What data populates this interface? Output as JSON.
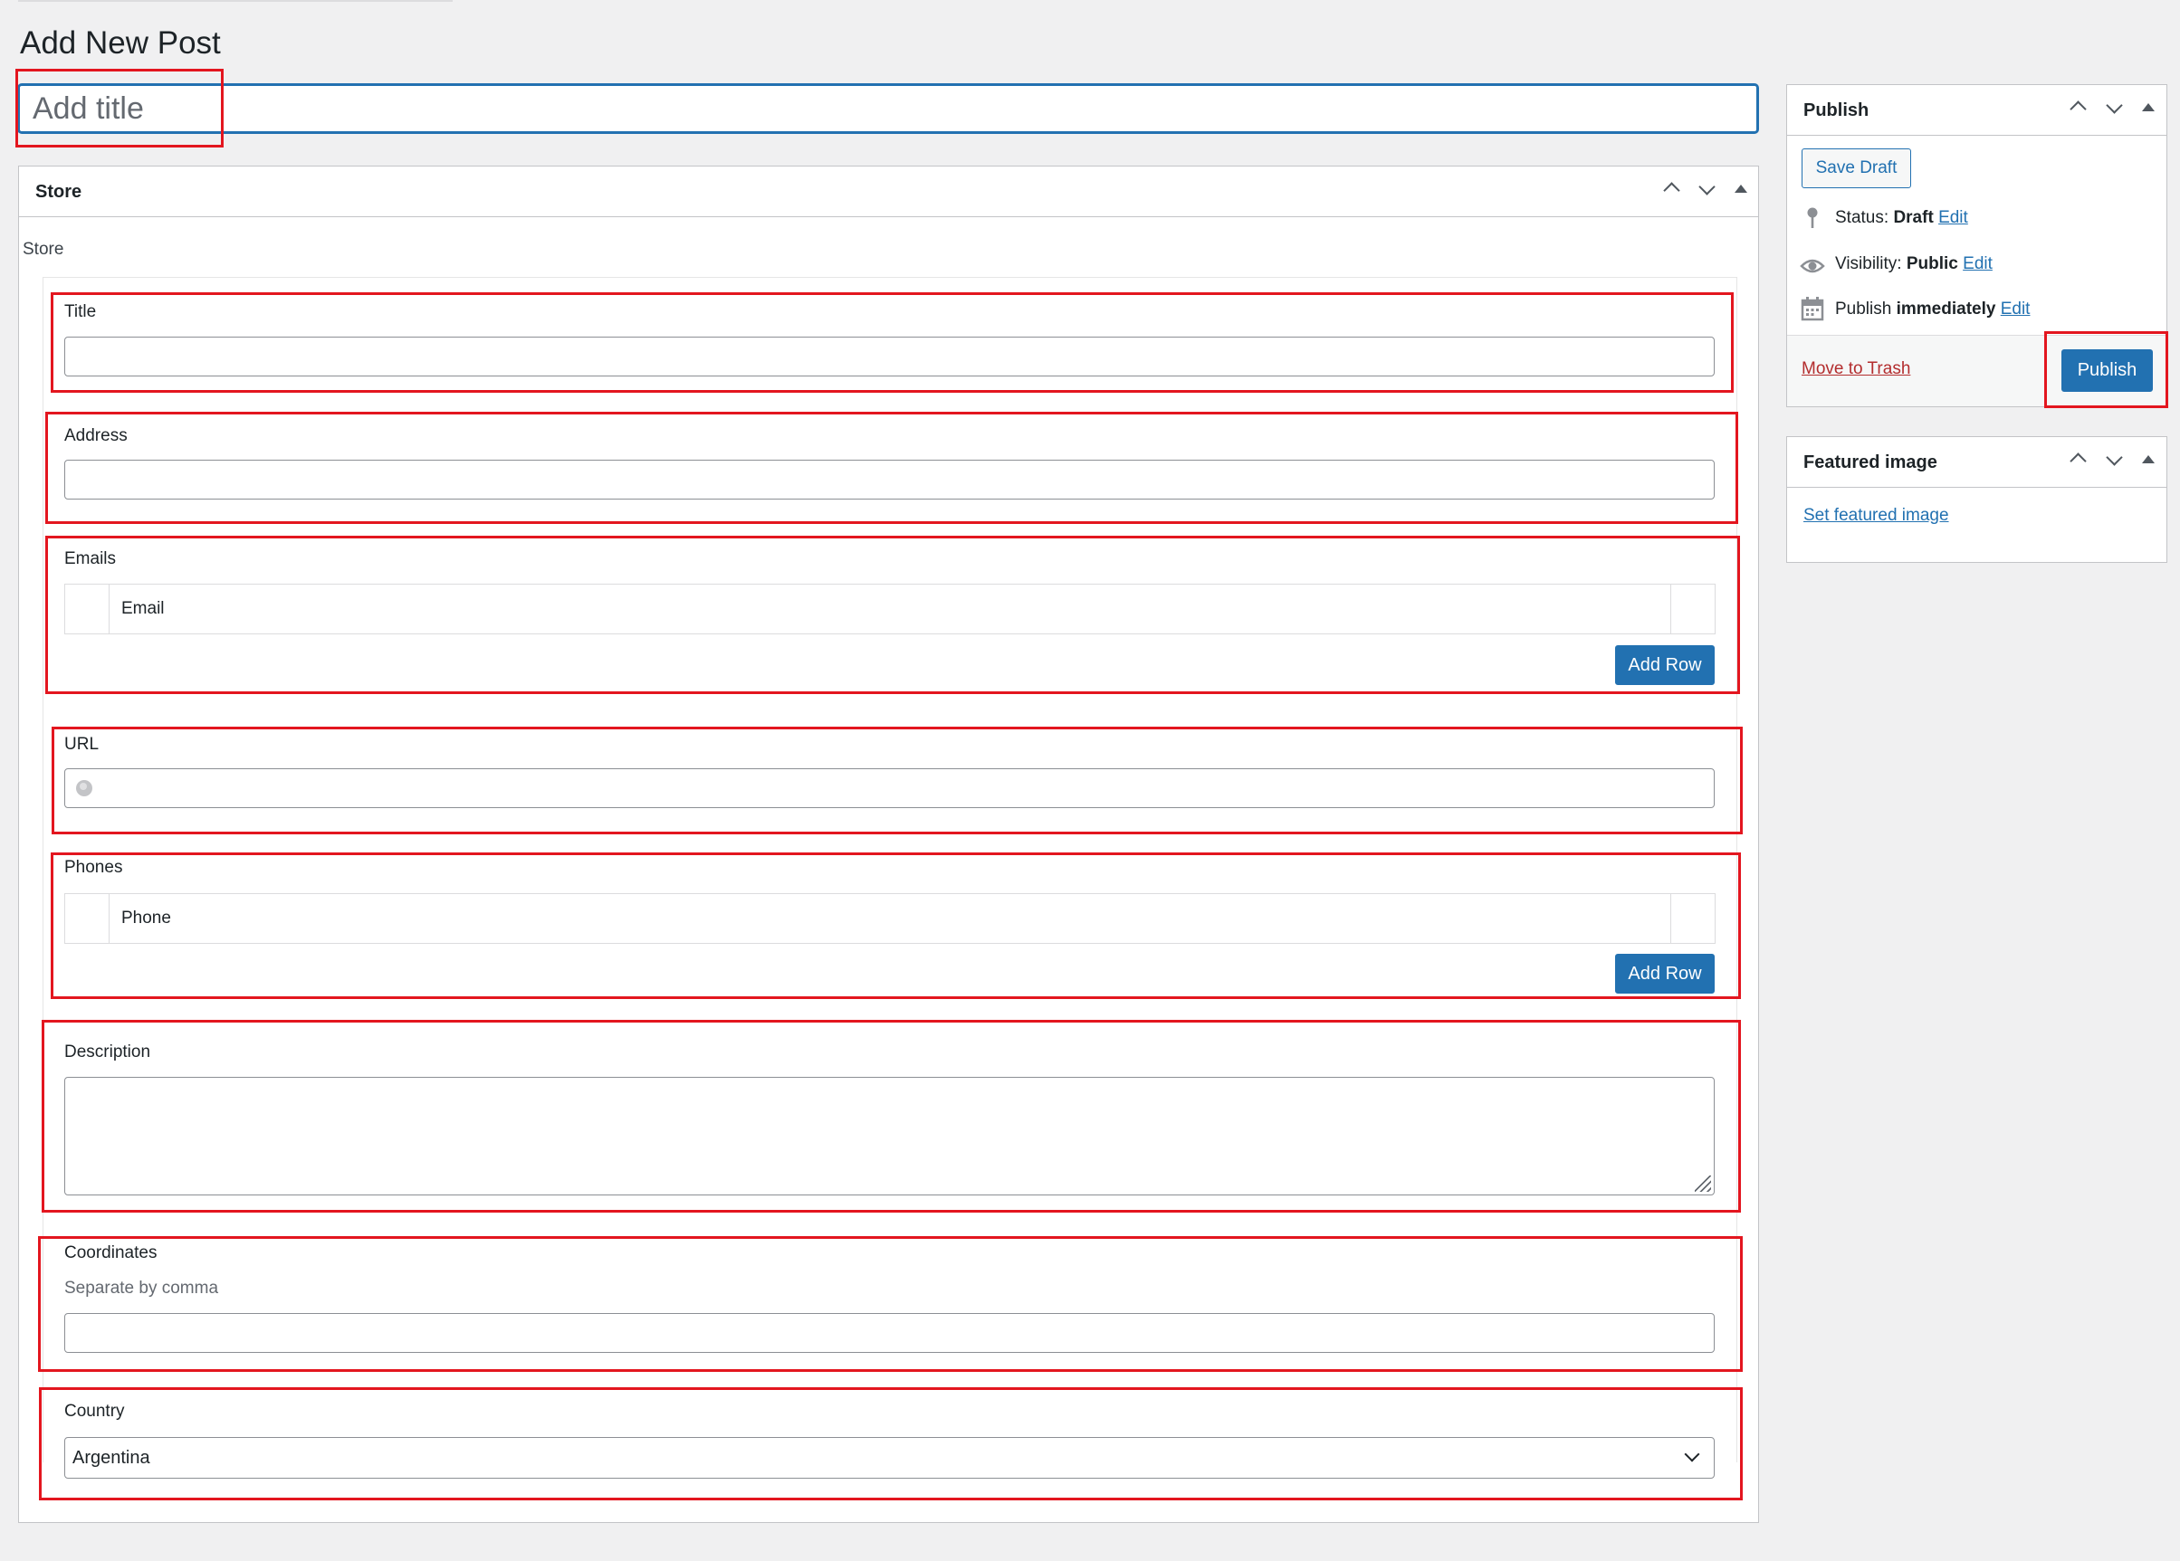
{
  "page": {
    "title": "Add New Post"
  },
  "post_title": {
    "placeholder": "Add title",
    "value": ""
  },
  "store_box": {
    "header": "Store",
    "section_label": "Store",
    "fields": {
      "title": {
        "label": "Title",
        "value": ""
      },
      "address": {
        "label": "Address",
        "value": ""
      },
      "emails": {
        "label": "Emails",
        "column": "Email",
        "add_button": "Add Row"
      },
      "url": {
        "label": "URL",
        "value": "",
        "icon": "globe-icon"
      },
      "phones": {
        "label": "Phones",
        "column": "Phone",
        "add_button": "Add Row"
      },
      "description": {
        "label": "Description",
        "value": ""
      },
      "coordinates": {
        "label": "Coordinates",
        "hint": "Separate by comma",
        "value": ""
      },
      "country": {
        "label": "Country",
        "selected": "Argentina"
      }
    }
  },
  "publish_box": {
    "header": "Publish",
    "save_draft": "Save Draft",
    "status_label": "Status:",
    "status_value": "Draft",
    "visibility_label": "Visibility:",
    "visibility_value": "Public",
    "publish_label": "Publish",
    "publish_value": "immediately",
    "edit": "Edit",
    "move_to_trash": "Move to Trash",
    "publish_button": "Publish"
  },
  "featured_box": {
    "header": "Featured image",
    "set_link": "Set featured image"
  },
  "colors": {
    "accent": "#2271b1",
    "highlight": "#e3161f",
    "trash": "#b32d2e",
    "background": "#f0f0f1"
  }
}
